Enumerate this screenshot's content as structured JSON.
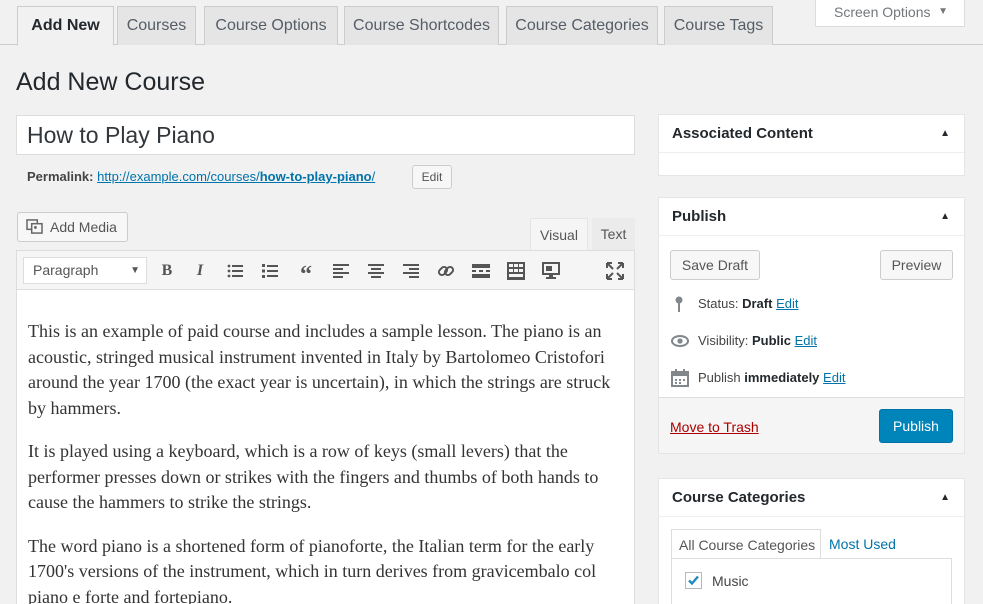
{
  "tabs": [
    "Add New",
    "Courses",
    "Course Options",
    "Course Shortcodes",
    "Course Categories",
    "Course Tags"
  ],
  "screen_options": "Screen Options",
  "page_title": "Add New Course",
  "post_title": "How to Play Piano",
  "permalink": {
    "label": "Permalink:",
    "base_url": "http://example.com/courses/",
    "slug": "how-to-play-piano",
    "trailing": "/",
    "edit_label": "Edit"
  },
  "editor": {
    "add_media_label": "Add Media",
    "tab_visual": "Visual",
    "tab_text": "Text",
    "format_select": "Paragraph",
    "toolbar_icons": [
      "bold-icon",
      "italic-icon",
      "bulleted-list-icon",
      "numbered-list-icon",
      "blockquote-icon",
      "align-left-icon",
      "align-center-icon",
      "align-right-icon",
      "insert-link-icon",
      "read-more-icon",
      "toolbar-toggle-icon",
      "distraction-free-icon",
      "fullscreen-icon"
    ],
    "paragraphs": [
      "This is an example of paid course and includes a sample lesson. The piano is an acoustic, stringed musical instrument invented in Italy by Bartolomeo Cristofori around the year 1700 (the exact year is uncertain), in which the strings are struck by hammers.",
      "It is played using a keyboard, which is a row of keys (small levers) that the performer presses down or strikes with the fingers and thumbs of both hands to cause the hammers to strike the strings.",
      "The word piano is a shortened form of pianoforte, the Italian term for the early 1700's versions of the instrument, which in turn derives from gravicembalo col piano e forte and fortepiano."
    ]
  },
  "sidebar": {
    "associated_content": {
      "title": "Associated Content"
    },
    "publish": {
      "title": "Publish",
      "save_draft": "Save Draft",
      "preview": "Preview",
      "status_label": "Status:",
      "status_value": "Draft",
      "visibility_label": "Visibility:",
      "visibility_value": "Public",
      "publish_label": "Publish",
      "publish_value": "immediately",
      "edit_link": "Edit",
      "move_to_trash": "Move to Trash",
      "publish_button": "Publish"
    },
    "course_categories": {
      "title": "Course Categories",
      "tab_all": "All Course Categories",
      "tab_most_used": "Most Used",
      "items": [
        {
          "label": "Music",
          "checked": true
        }
      ]
    }
  },
  "colors": {
    "primary_button": "#0085ba",
    "link": "#0073aa",
    "trash": "#a00",
    "background": "#f1f1f1"
  }
}
